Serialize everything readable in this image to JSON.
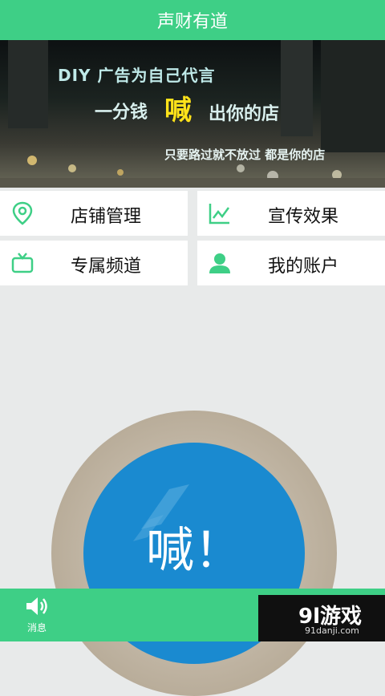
{
  "header": {
    "title": "声财有道"
  },
  "banner": {
    "line1": "DIY 广告为自己代言",
    "line2_pre": "一分钱",
    "line2_highlight": "喊",
    "line2_post": "出你的店",
    "line3": "只要路过就不放过  都是你的店"
  },
  "menu": {
    "items": [
      {
        "label": "店铺管理",
        "icon": "map-marker-icon"
      },
      {
        "label": "宣传效果",
        "icon": "line-chart-icon"
      },
      {
        "label": "专属频道",
        "icon": "tv-icon"
      },
      {
        "label": "我的账户",
        "icon": "user-icon"
      }
    ]
  },
  "shout_button": {
    "label": "喊！"
  },
  "bottom_bar": {
    "message_label": "消息"
  },
  "watermark": {
    "brand": "9l游戏",
    "url": "91danji.com"
  },
  "colors": {
    "accent": "#3ecf86",
    "shout_blue": "#1a8ad0",
    "icon_green": "#3ecf86"
  }
}
